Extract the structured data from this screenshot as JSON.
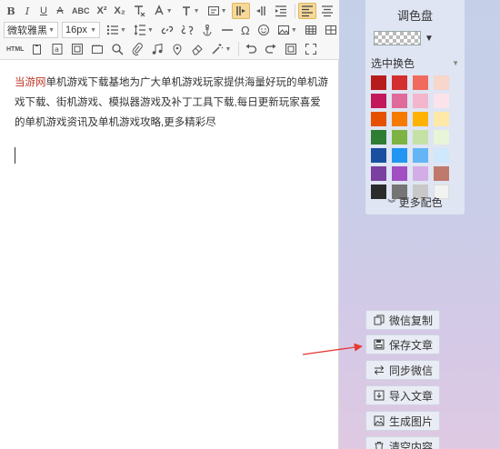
{
  "toolbar": {
    "bold": "B",
    "italic": "I",
    "underline": "U",
    "strikethrough": "A",
    "font_format": "ABC",
    "superscript": "X²",
    "subscript": "X₂",
    "font_family": "微软雅黑",
    "font_size": "16px",
    "html_label": "HTML"
  },
  "content": {
    "brand": "当游网",
    "body": "单机游戏下载基地为广大单机游戏玩家提供海量好玩的单机游戏下载、街机游戏、模拟器游戏及补丁工具下载,每日更新玩家喜爱的单机游戏资讯及单机游戏攻略,更多精彩尽"
  },
  "palette": {
    "title": "调色盘",
    "subtitle": "选中换色",
    "more": "更多配色",
    "colors": [
      "#b71c1c",
      "#d32f2f",
      "#f06b5e",
      "#f7d6cc",
      "#c2185b",
      "#e06a9a",
      "#f3b6cc",
      "#fbe3ec",
      "#e65100",
      "#f57c00",
      "#ffb300",
      "#ffe9a8",
      "#2e7d32",
      "#7cb342",
      "#c5e1a5",
      "#e9f5d8",
      "#1a4fa0",
      "#2196f3",
      "#64b5f6",
      "#cfe8fb",
      "#7b3fa0",
      "#a14fc2",
      "#d3aee6",
      "#c07a6c",
      "#2b2b2b",
      "#757575",
      "#c8c8c8",
      "#f2f2f2"
    ]
  },
  "actions": {
    "copy_wechat": "微信复制",
    "save_article": "保存文章",
    "sync_wechat": "同步微信",
    "import_article": "导入文章",
    "generate_image": "生成图片",
    "clear_content": "清空内容"
  }
}
